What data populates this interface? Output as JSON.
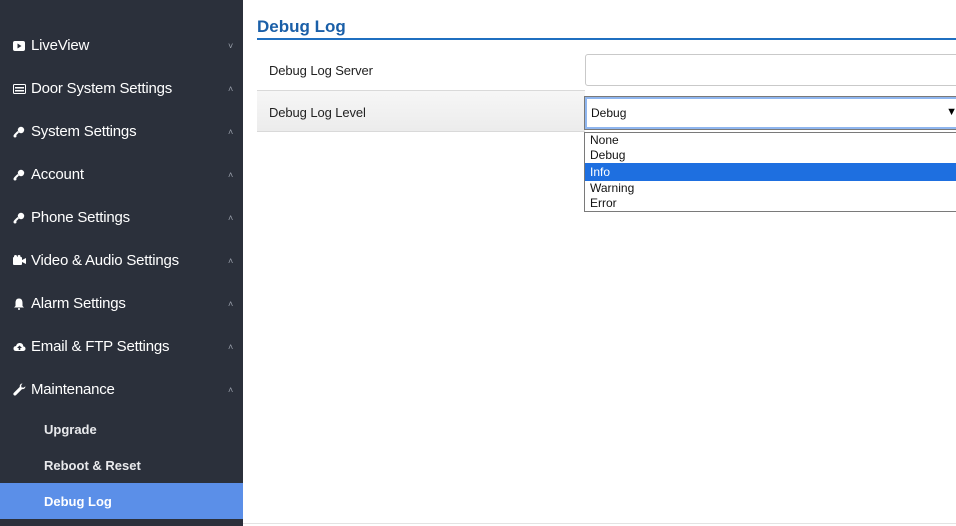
{
  "sidebar": {
    "items": [
      {
        "label": "LiveView",
        "icon": "video-icon",
        "caret": "˅"
      },
      {
        "label": "Door System Settings",
        "icon": "door-panel-icon",
        "caret": "˄"
      },
      {
        "label": "System Settings",
        "icon": "key-icon",
        "caret": "˄"
      },
      {
        "label": "Account",
        "icon": "key-icon",
        "caret": "˄"
      },
      {
        "label": "Phone Settings",
        "icon": "key-icon",
        "caret": "˄"
      },
      {
        "label": "Video & Audio Settings",
        "icon": "camera-icon",
        "caret": "˄"
      },
      {
        "label": "Alarm Settings",
        "icon": "bell-icon",
        "caret": "˄"
      },
      {
        "label": "Email & FTP Settings",
        "icon": "cloud-icon",
        "caret": "˄"
      },
      {
        "label": "Maintenance",
        "icon": "wrench-icon",
        "caret": "˄"
      }
    ],
    "subitems": [
      {
        "label": "Upgrade"
      },
      {
        "label": "Reboot & Reset"
      },
      {
        "label": "Debug Log"
      }
    ],
    "active_color": "#5b8fe8",
    "background": "#2b303b"
  },
  "main": {
    "title": "Debug Log",
    "server_label": "Debug Log Server",
    "server_value": "",
    "level_label": "Debug Log Level",
    "level_selected": "Debug",
    "level_options": [
      "None",
      "Debug",
      "Info",
      "Warning",
      "Error"
    ],
    "highlighted_option": "Info",
    "title_color": "#1a5fa8"
  }
}
